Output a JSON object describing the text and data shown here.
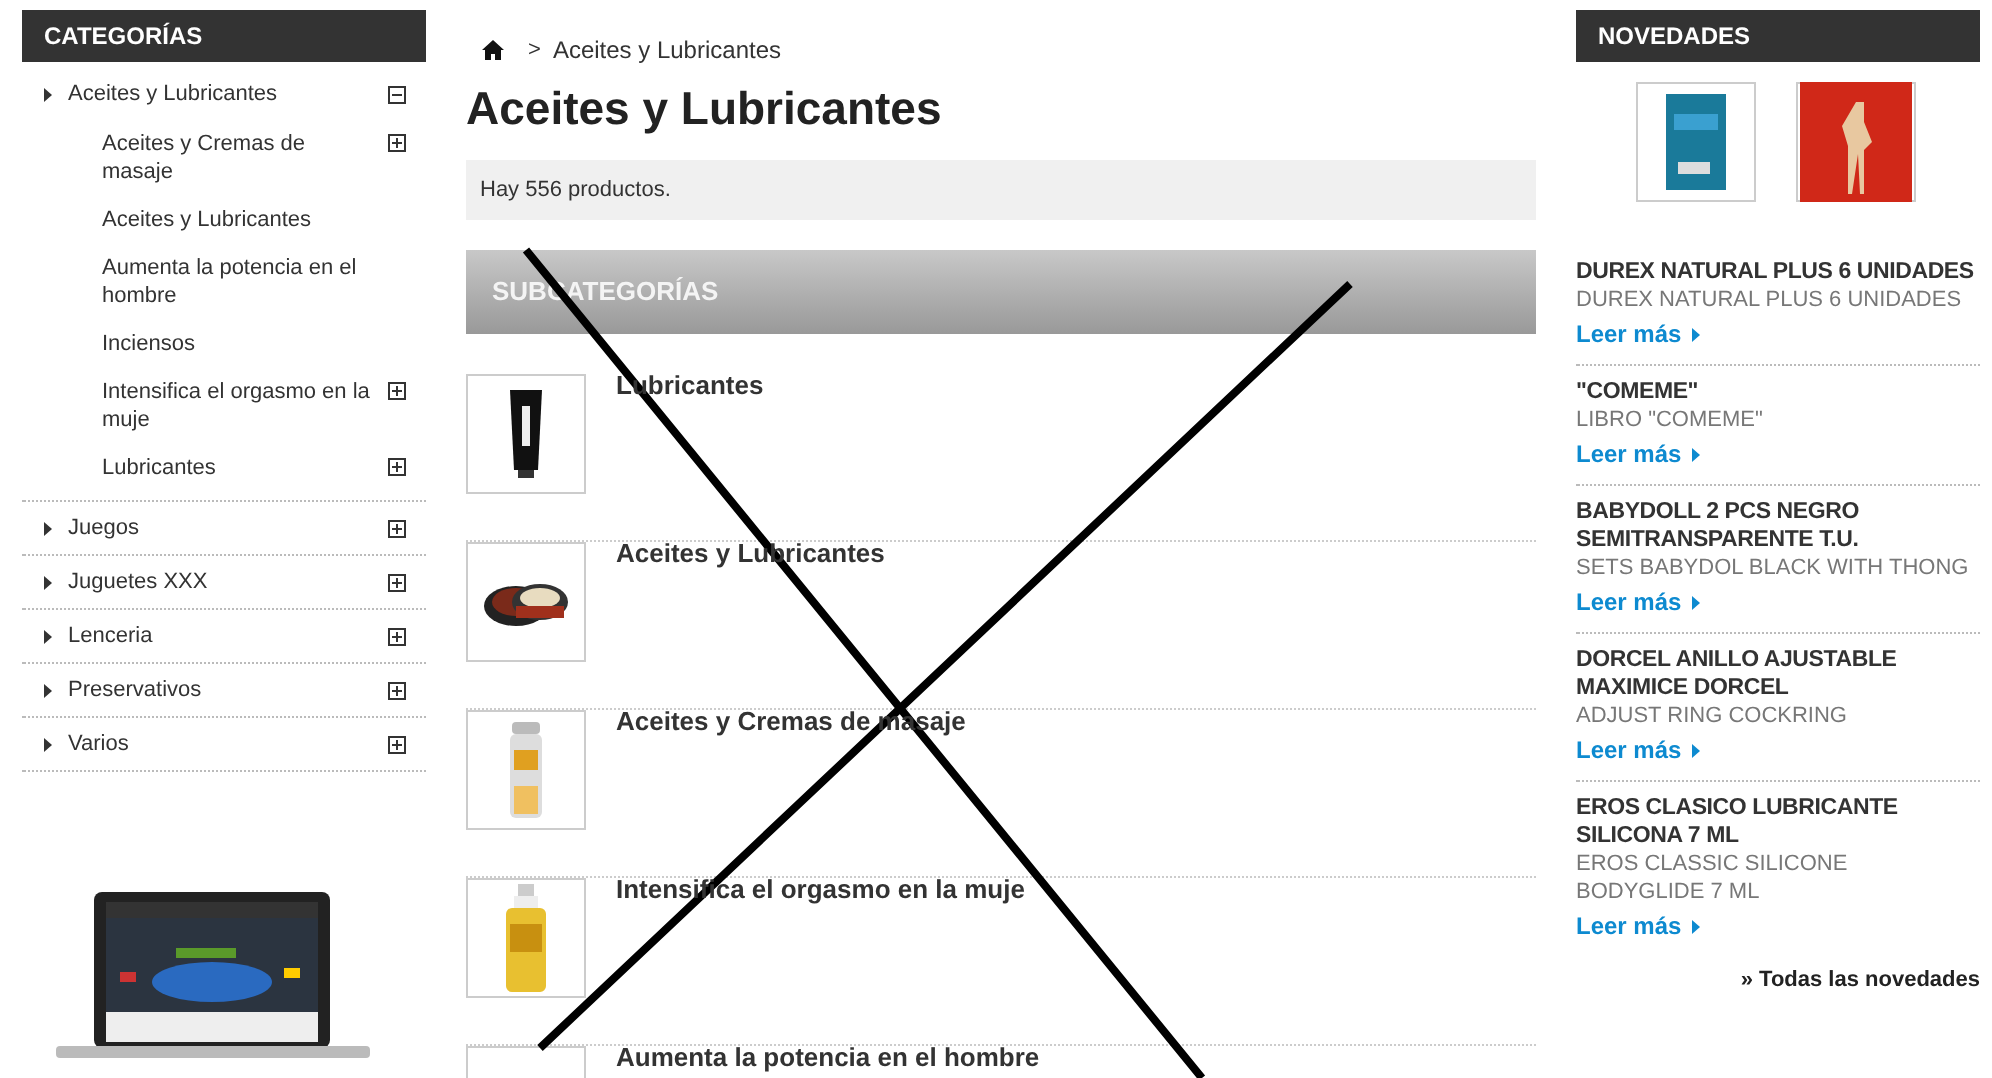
{
  "sidebar": {
    "title": "CATEGORÍAS",
    "items": [
      {
        "label": "Aceites y Lubricantes",
        "expanded": true,
        "children": [
          {
            "label": "Aceites y Cremas de masaje",
            "has_children": true
          },
          {
            "label": "Aceites y Lubricantes",
            "has_children": false
          },
          {
            "label": "Aumenta la potencia en el hombre",
            "has_children": false
          },
          {
            "label": "Inciensos",
            "has_children": false
          },
          {
            "label": "Intensifica el orgasmo en la muje",
            "has_children": true
          },
          {
            "label": "Lubricantes",
            "has_children": true
          }
        ]
      },
      {
        "label": "Juegos",
        "expanded": false
      },
      {
        "label": "Juguetes XXX",
        "expanded": false
      },
      {
        "label": "Lenceria",
        "expanded": false
      },
      {
        "label": "Preservativos",
        "expanded": false
      },
      {
        "label": "Varios",
        "expanded": false
      }
    ]
  },
  "breadcrumb": {
    "separator": ">",
    "current": "Aceites y Lubricantes"
  },
  "page_title": "Aceites y Lubricantes",
  "product_count": "Hay 556 productos.",
  "subcategories": {
    "title": "SUBCATEGORÍAS",
    "items": [
      {
        "name": "Lubricantes",
        "kind": "tube"
      },
      {
        "name": "Aceites y Lubricantes",
        "kind": "tin"
      },
      {
        "name": "Aceites y Cremas de masaje",
        "kind": "bottle"
      },
      {
        "name": "Intensifica el orgasmo en la muje",
        "kind": "pump"
      },
      {
        "name": "Aumenta la potencia en el hombre",
        "kind": "blank"
      }
    ]
  },
  "novedades": {
    "title": "NOVEDADES",
    "thumbnails": [
      {
        "kind": "box"
      },
      {
        "kind": "book"
      }
    ],
    "items": [
      {
        "title": "DUREX NATURAL PLUS 6 UNIDADES",
        "subtitle": "DUREX NATURAL PLUS 6 UNIDADES",
        "link": "Leer más"
      },
      {
        "title": "\"COMEME\"",
        "subtitle": "LIBRO \"COMEME\"",
        "link": "Leer más"
      },
      {
        "title": "BABYDOLL 2 PCS NEGRO SEMITRANSPARENTE T.U.",
        "subtitle": "SETS BABYDOL BLACK WITH THONG",
        "link": "Leer más"
      },
      {
        "title": "DORCEL ANILLO AJUSTABLE MAXIMICE DORCEL",
        "subtitle": "ADJUST RING COCKRING",
        "link": "Leer más"
      },
      {
        "title": "EROS CLASICO LUBRICANTE SILICONA 7 ML",
        "subtitle": "EROS CLASSIC SILICONE BODYGLIDE 7 ML",
        "link": "Leer más"
      }
    ],
    "all_link": "» Todas las novedades"
  }
}
